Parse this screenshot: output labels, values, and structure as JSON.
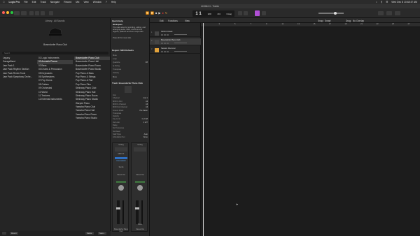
{
  "menubar": {
    "app": "Logic Pro",
    "items": [
      "File",
      "Edit",
      "Track",
      "Navigate",
      "Record",
      "Mix",
      "View",
      "Window",
      "?",
      "Help"
    ],
    "clock": "Wed Dec 8  10:48:47 AM"
  },
  "window": {
    "title": "Untitled 4 - Tracks"
  },
  "lcd": {
    "position": "1  1",
    "tempo": "120",
    "tempo_label": "KEEP",
    "signature": "4/4",
    "key": "Cmaj"
  },
  "library": {
    "header": "Library - All Sounds",
    "patch_name": "Bosendorfer Piano Club",
    "search_placeholder": "Search",
    "col1": [
      "Legacy",
      "GarageBand",
      "Jam Pack 1",
      "Jam Pack Rhythm Section",
      "Jam Pack Remix Tools",
      "Jam Pack Symphony Orche..."
    ],
    "col1_selected": -1,
    "col2": [
      "01 Logic Instruments",
      "02 Acoustic Pianos",
      "03 Bass",
      "04 Drums & Percussion",
      "05 Keyboards",
      "06 Synthesizers",
      "07 Pop Horns",
      "08 Guitars",
      "09 Orchestral",
      "10 World",
      "11 Textures",
      "12 External Instruments"
    ],
    "col2_selected": 1,
    "col3": [
      "Bosendorfer Piano Club",
      "Bosendorfer Piano Hall",
      "Bosendorfer Piano Room",
      "Bosendorfer Piano Studio",
      "Pop Piano & Bass",
      "Pop Piano & Strings",
      "Pop Piano & Pad",
      "Pop Piano Plus",
      "Steinway Piano Club",
      "Steinway Piano Hall",
      "Steinway Piano Room",
      "Steinway Piano Studio",
      "Warped Piano",
      "Yamaha Piano Club",
      "Yamaha Piano Hall",
      "Yamaha Piano Room",
      "Yamaha Piano Studio"
    ],
    "col3_selected": 0,
    "footer": {
      "revert": "Revert",
      "delete": "Delete",
      "save": "Save..."
    }
  },
  "quickhelp": {
    "title": "Quick Help",
    "heading": "Workspace",
    "body": "The main area for recording, editing, and arranging audio, MIDI, and Drummer regions, patterns and Live Loops cells.",
    "shortcut": "Press ⌘/ for more info."
  },
  "inspector": {
    "region_title": "Region: MIDI Defaults",
    "region_props": [
      [
        "Mute",
        ""
      ],
      [
        "Loop",
        ""
      ],
      [
        "Quantize",
        "Off"
      ],
      [
        "Q-Swing",
        ""
      ],
      [
        "Transpose",
        ""
      ],
      [
        "Velocity",
        ""
      ]
    ],
    "more": "More",
    "track_title": "Track: Bosendorfer Piano Club",
    "track_props": [
      [
        "Icon",
        ""
      ],
      [
        "Channel",
        "Inst 1"
      ],
      [
        "MIDI In Port",
        "All"
      ],
      [
        "MIDI In Channel",
        "All"
      ],
      [
        "MIDI Out Channel",
        "All"
      ],
      [
        "Freeze Mode",
        "Pre Fader"
      ],
      [
        "Transpose",
        ""
      ],
      [
        "Velocity",
        ""
      ],
      [
        "Key Limit",
        "C-2 G8"
      ],
      [
        "Vel Limit",
        "1 127"
      ],
      [
        "Delay",
        ""
      ],
      [
        "No Transpose",
        ""
      ],
      [
        "No Reset",
        ""
      ],
      [
        "Staff Style",
        "Auto"
      ],
      [
        "Articulation Set",
        "None"
      ]
    ]
  },
  "strips": {
    "left": {
      "setting": "Setting",
      "eq": "EQ",
      "midi_fx": "MIDI FX",
      "instrument": "Sampler",
      "audio_fx": "ChromaVerb",
      "sends": "Sends",
      "output": "Stereo Out",
      "group": "Group",
      "read": "Read",
      "pan": "0.0",
      "name": "Bosendorfer Piano Club"
    },
    "right": {
      "setting": "Setting",
      "eq": "EQ",
      "output": "Stereo Out",
      "read": "Read",
      "pan": "0.0",
      "bounce": "Bnce",
      "name": "Stereo Out"
    }
  },
  "tracks_header": {
    "edit": "Edit",
    "functions": "Functions",
    "view": "View",
    "snap": "Snap:",
    "snap_value": "Smart",
    "drag": "Drag:",
    "drag_value": "No Overlap"
  },
  "tracks": [
    {
      "num": "1",
      "name": "SFW FX Bank",
      "selected": false
    },
    {
      "num": "2",
      "name": "Bosendorfer Piano Club",
      "selected": true
    },
    {
      "num": "3",
      "name": "Session Drummer",
      "selected": false
    }
  ],
  "ruler": [
    "1",
    "3",
    "5",
    "7",
    "9",
    "11",
    "13",
    "15",
    "17",
    "19",
    "21",
    "23",
    "25",
    "27"
  ]
}
